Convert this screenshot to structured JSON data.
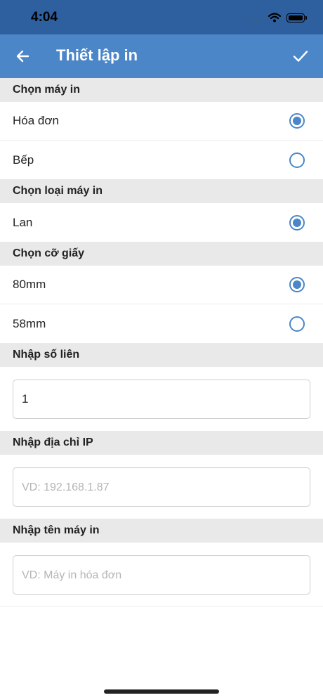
{
  "status_bar": {
    "time": "4:04"
  },
  "nav": {
    "title": "Thiết lập in",
    "back_icon": "arrow-left-icon",
    "confirm_icon": "check-icon"
  },
  "sections": {
    "printer": {
      "header": "Chọn máy in",
      "options": [
        {
          "label": "Hóa đơn",
          "selected": true
        },
        {
          "label": "Bếp",
          "selected": false
        }
      ]
    },
    "printer_type": {
      "header": "Chọn loại máy in",
      "options": [
        {
          "label": "Lan",
          "selected": true
        }
      ]
    },
    "paper_size": {
      "header": "Chọn cỡ giấy",
      "options": [
        {
          "label": "80mm",
          "selected": true
        },
        {
          "label": "58mm",
          "selected": false
        }
      ]
    },
    "copies": {
      "header": "Nhập số liên",
      "value": "1",
      "placeholder": ""
    },
    "ip": {
      "header": "Nhập địa chỉ IP",
      "value": "",
      "placeholder": "VD: 192.168.1.87"
    },
    "printer_name": {
      "header": "Nhập tên máy in",
      "value": "",
      "placeholder": "VD: Máy in hóa đơn"
    }
  },
  "colors": {
    "primary": "#4a86c8",
    "status_bar": "#2e5f9e",
    "section_bg": "#e9e9e9"
  }
}
